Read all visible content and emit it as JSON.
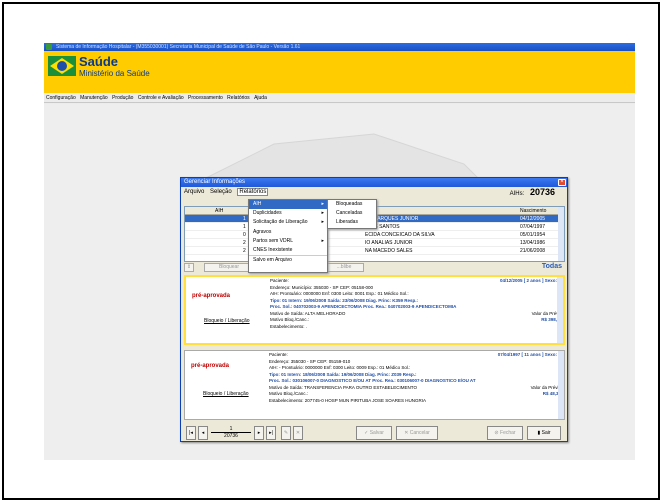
{
  "window": {
    "title": "Sistema de Informação Hospitalar - (M355030001) Secretaria Municipal de Saúde de São Paulo          - Versão 1.61"
  },
  "brand": {
    "name": "Saúde",
    "subtitle": "Ministério da Saúde"
  },
  "menu": [
    "Configuração",
    "Manutenção",
    "Produção",
    "Controle e Avaliação",
    "Processamento",
    "Relatórios",
    "Ajuda"
  ],
  "dialog": {
    "title": "Gerenciar Informações",
    "menu": [
      "Arquivo",
      "Seleção",
      "Relatórios"
    ],
    "aihs_label": "AIHs:",
    "aihs_count": "20736",
    "grid": {
      "headers": {
        "aih": "AIH",
        "nascimento": "Nascimento"
      },
      "rows": [
        {
          "c1": "1",
          "nome": "ES MARQUES JUNIOR",
          "nasc": "04/12/2005"
        },
        {
          "c1": "1",
          "nome": "...IOS SANTOS",
          "nasc": "07/04/1997"
        },
        {
          "c1": "0",
          "nome": "ECIDA CONCEICAO DA SILVA",
          "nasc": "05/01/1954"
        },
        {
          "c1": "2",
          "nome": "IO ANALIAS JUNIOR",
          "nasc": "13/04/1986"
        },
        {
          "c1": "2",
          "nome": "NA MACEDO SALES",
          "nasc": "21/06/2008"
        }
      ]
    },
    "buttons": {
      "bloquear": "Bloquear",
      "desbloquear": "...blibe",
      "todas": "Todas"
    },
    "cards": [
      {
        "status": "pré-aprovada",
        "link": "Bloqueio / Liberação",
        "rows": [
          {
            "l": "Paciente:",
            "r": "04/12/2005   [ 2 anos ] Sexo: M"
          },
          {
            "l": "Endereço:                                                Município: 355030 - SP CEP: 05158-000"
          },
          {
            "l": "AIH:                    Prontuário: 0000000 Enf: 0300 Leito: 0001  Esp.: 01   Médico Sol.:"
          },
          {
            "l": "Tipo: 01  Intern: 19/06/2008  Saída: 23/06/2008  Diag. Princ: K359         Resp.:"
          },
          {
            "l": "Proc. Sol.: 040702003-9 APENDICECTOMIA          Proc. Rea.: 040702003-9 APENDICECTOMIA"
          },
          {
            "l": "Motivo de Saída: ALTA MELHORADO",
            "r": "Valor da Prévia"
          },
          {
            "l": "Motivo Bloq./Canc.:",
            "r": "R$ 398,88"
          },
          {
            "l": "Estabelecimento: ."
          }
        ]
      },
      {
        "status": "pré-aprovada",
        "link": "Bloqueio / Liberação",
        "rows": [
          {
            "l": "Paciente:",
            "r": "07/04/1997   [ 11 anos ] Sexo: F"
          },
          {
            "l": "Endereço:                                                355030 - SP CEP: 05159-010"
          },
          {
            "l": "AIH: -                 Prontuário: 0000000 Enf: 0300 Leito: 0009  Esp.: 01   Médico Sol.:"
          },
          {
            "l": "Tipo: 01  Intern: 18/06/2008  Saída: 19/06/2008  Diag. Princ: Z039         Resp.:"
          },
          {
            "l": "Proc. Sol.: 030106007-0 DIAGNOSTICO E/OU AT     Proc. Rea.: 030106007-0 DIAGNOSTICO E/OU AT"
          },
          {
            "l": "Motivo de Saída: TRANSFERENCIA PARA OUTRO ESTABELECIMENTO",
            "r": "Valor da Prévia"
          },
          {
            "l": "Motivo Bloq./Canc.:",
            "r": "R$ 48,37"
          },
          {
            "l": "Estabelecimento: 207745-0 HOSP MUN PIRITUBA JOSE SOARES HUNGRIA"
          }
        ]
      }
    ],
    "pager": {
      "current": "1",
      "total": "20736"
    },
    "footer": {
      "salvar": "Salvar",
      "cancelar": "Cancelar",
      "fechar": "Fechar",
      "sair": "Sair"
    }
  },
  "dropdown": {
    "items": [
      "AIH",
      "Duplicidades",
      "Solicitação de Liberação",
      "Agravos",
      "Partos sem VDRL",
      "CNES Inexistente",
      "Salvo em Arquivo"
    ],
    "submenu": [
      "Bloqueadas",
      "Canceladas",
      "Liberadas"
    ]
  },
  "colors": {
    "banner": "#ffcc00",
    "titlebar": "#1f58d8",
    "status": "#c00000"
  }
}
